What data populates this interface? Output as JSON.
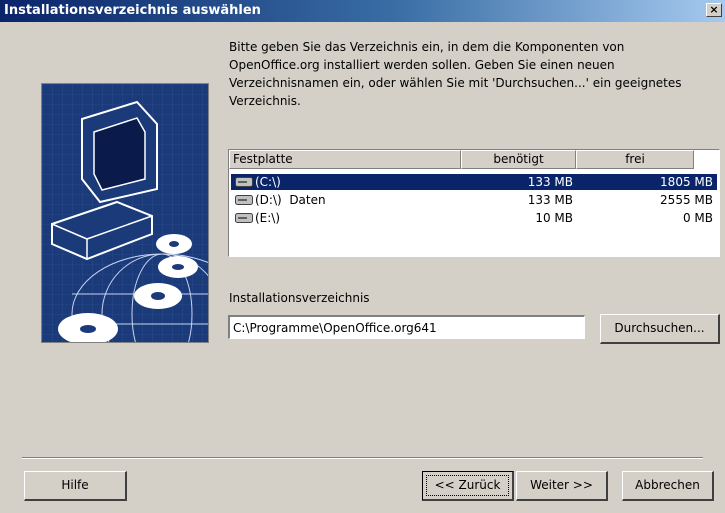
{
  "window": {
    "title": "Installationsverzeichnis auswählen",
    "close_label": "×"
  },
  "description": "Bitte geben Sie das Verzeichnis ein, in dem die Komponenten von OpenOffice.org installiert werden sollen. Geben Sie einen neuen Verzeichnisnamen ein, oder wählen Sie mit 'Durchsuchen...' ein geeignetes Verzeichnis.",
  "drives_table": {
    "headers": [
      "Festplatte",
      "benötigt",
      "frei"
    ],
    "rows": [
      {
        "drive": "(C:\\)",
        "needed": "133 MB",
        "free": "1805 MB",
        "selected": true
      },
      {
        "drive": "(D:\\)  Daten",
        "needed": "133 MB",
        "free": "2555 MB",
        "selected": false
      },
      {
        "drive": "(E:\\)",
        "needed": "10 MB",
        "free": "0 MB",
        "selected": false
      }
    ]
  },
  "install_dir": {
    "label": "Installationsverzeichnis",
    "value": "C:\\Programme\\OpenOffice.org641"
  },
  "buttons": {
    "browse": "Durchsuchen...",
    "help": "Hilfe",
    "back": "<< Zurück",
    "next": "Weiter >>",
    "cancel": "Abbrechen"
  }
}
